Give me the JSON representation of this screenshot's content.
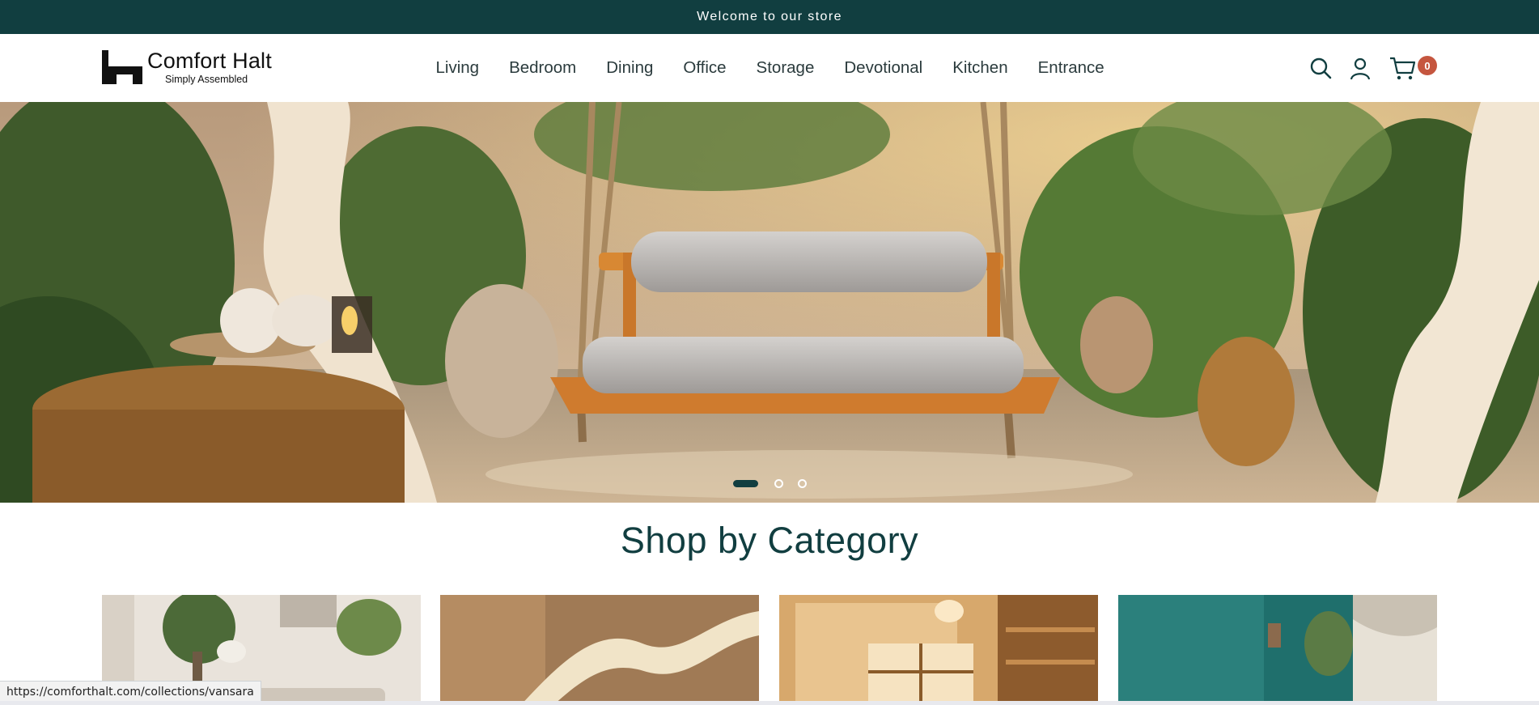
{
  "announcement": {
    "text": "Welcome to our store"
  },
  "header": {
    "brand_name": "Comfort Halt",
    "brand_tagline": "Simply Assembled",
    "nav": [
      {
        "label": "Living"
      },
      {
        "label": "Bedroom"
      },
      {
        "label": "Dining"
      },
      {
        "label": "Office"
      },
      {
        "label": "Storage"
      },
      {
        "label": "Devotional"
      },
      {
        "label": "Kitchen"
      },
      {
        "label": "Entrance"
      }
    ],
    "icons": [
      "search-icon",
      "account-icon",
      "cart-icon"
    ],
    "cart_count": "0"
  },
  "hero": {
    "slides_total": 3,
    "active_slide": 1
  },
  "section": {
    "title": "Shop by Category"
  },
  "status": {
    "url": "https://comforthalt.com/collections/vansara"
  },
  "colors": {
    "brand_dark": "#113e40",
    "badge": "#c5563f",
    "nav_text": "#2b3b3d"
  }
}
